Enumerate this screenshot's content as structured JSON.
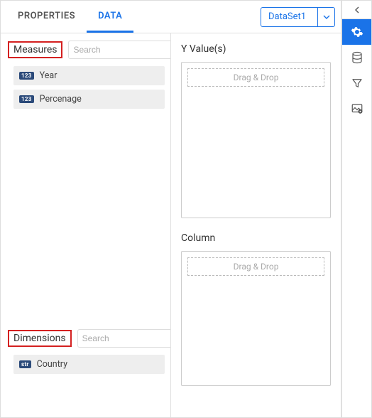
{
  "tabs": {
    "properties": "PROPERTIES",
    "data": "DATA"
  },
  "dataset": {
    "selected": "DataSet1"
  },
  "measures": {
    "title": "Measures",
    "search_placeholder": "Search",
    "fields": [
      {
        "badge": "123",
        "label": "Year"
      },
      {
        "badge": "123",
        "label": "Percenage"
      }
    ]
  },
  "dimensions": {
    "title": "Dimensions",
    "search_placeholder": "Search",
    "fields": [
      {
        "badge": "str",
        "label": "Country"
      }
    ]
  },
  "drops": {
    "yvalues": {
      "title": "Y Value(s)",
      "hint": "Drag & Drop"
    },
    "column": {
      "title": "Column",
      "hint": "Drag & Drop"
    }
  }
}
